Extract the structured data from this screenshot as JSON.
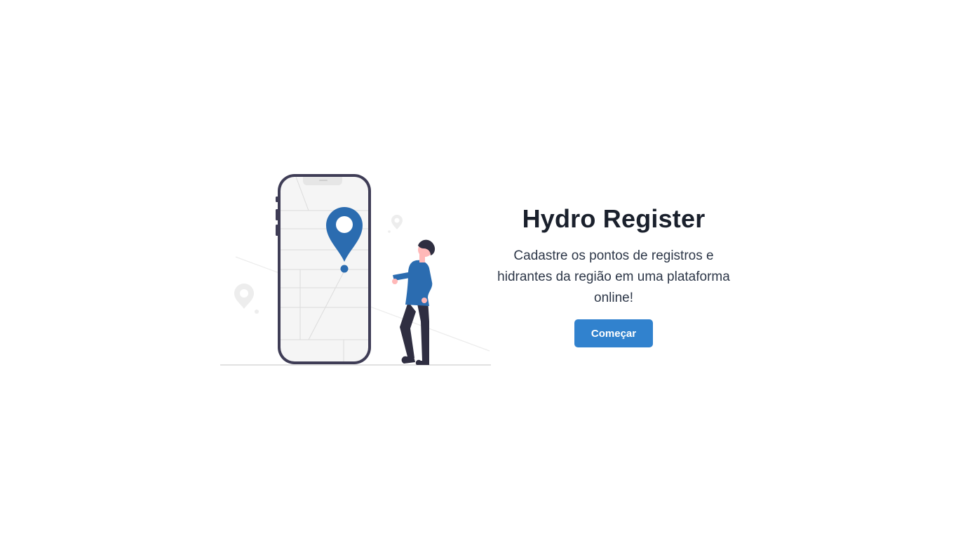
{
  "hero": {
    "title": "Hydro Register",
    "subtitle": "Cadastre os pontos de registros e hidrantes da região em uma plataforma online!",
    "cta_label": "Começar"
  },
  "illustration": {
    "icons": [
      "phone-icon",
      "location-pin-icon",
      "person-icon"
    ]
  },
  "colors": {
    "accent": "#3182ce",
    "illustration_blue": "#2b6cb0",
    "title": "#1a202c",
    "body_text": "#2d3748",
    "phone_frame": "#3f3d56",
    "figure_pants": "#2f2e41"
  }
}
